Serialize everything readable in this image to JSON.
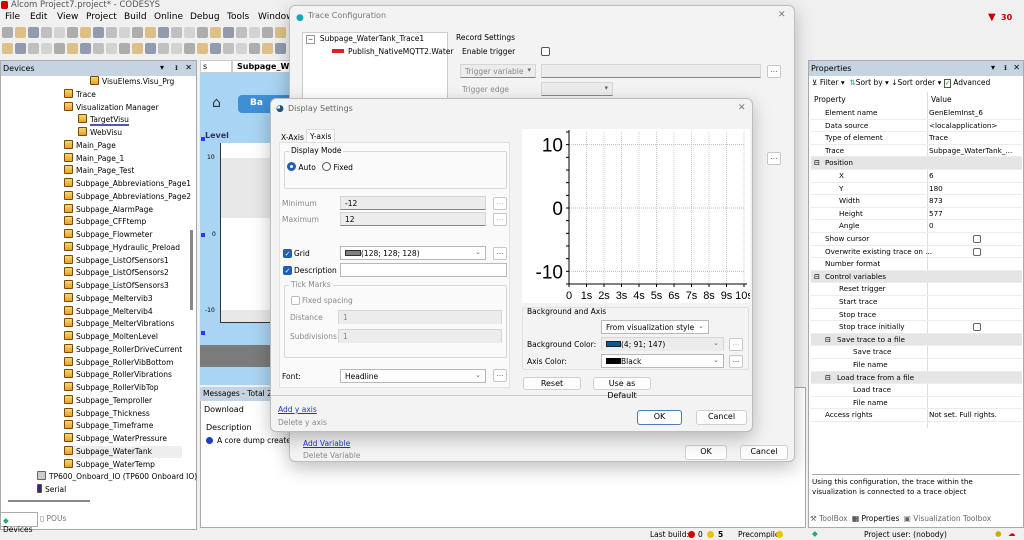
{
  "window": {
    "title": "Alcom Project7.project* - CODESYS",
    "error_count": "30"
  },
  "menu": [
    "File",
    "Edit",
    "View",
    "Project",
    "Build",
    "Online",
    "Debug",
    "Tools",
    "Window"
  ],
  "devices": {
    "title": "Devices",
    "items": [
      {
        "label": "VisuElems.Visu_Prg"
      },
      {
        "label": "Trace"
      },
      {
        "label": "Visualization Manager"
      },
      {
        "label": "TargetVisu"
      },
      {
        "label": "WebVisu"
      },
      {
        "label": "Main_Page"
      },
      {
        "label": "Main_Page_1"
      },
      {
        "label": "Main_Page_Test"
      },
      {
        "label": "Subpage_Abbreviations_Page1"
      },
      {
        "label": "Subpage_Abbreviations_Page2"
      },
      {
        "label": "Subpage_AlarmPage"
      },
      {
        "label": "Subpage_CFFtemp"
      },
      {
        "label": "Subpage_Flowmeter"
      },
      {
        "label": "Subpage_Hydraulic_Preload"
      },
      {
        "label": "Subpage_ListOfSensors1"
      },
      {
        "label": "Subpage_ListOfSensors2"
      },
      {
        "label": "Subpage_ListOfSensors3"
      },
      {
        "label": "Subpage_Meltervib3"
      },
      {
        "label": "Subpage_Meltervib4"
      },
      {
        "label": "Subpage_MelterVibrations"
      },
      {
        "label": "Subpage_MoltenLevel"
      },
      {
        "label": "Subpage_RollerDriveCurrent"
      },
      {
        "label": "Subpage_RollerVibBottom"
      },
      {
        "label": "Subpage_RollerVibrations"
      },
      {
        "label": "Subpage_RollerVibTop"
      },
      {
        "label": "Subpage_Temproller"
      },
      {
        "label": "Subpage_Thickness"
      },
      {
        "label": "Subpage_Timeframe"
      },
      {
        "label": "Subpage_WaterPressure"
      },
      {
        "label": "Subpage_WaterTank"
      },
      {
        "label": "Subpage_WaterTemp"
      },
      {
        "label": "TP600_Onboard_IO (TP600 Onboard IO)"
      },
      {
        "label": "Serial"
      }
    ],
    "tabs": [
      "Devices",
      "POUs"
    ]
  },
  "editor": {
    "tab_prev": "s",
    "tab_active": "Subpage_W",
    "button": "Ba",
    "trace_label": "Level",
    "ticks": [
      "10",
      "0",
      "-10"
    ]
  },
  "messages": {
    "title": "Messages - Total 2 e",
    "filter": "Download",
    "col": "Description",
    "row": "A core dump created"
  },
  "trace_config": {
    "title": "Trace Configuration",
    "tree_root": "Subpage_WaterTank_Trace1",
    "tree_var": "Publish_NativeMQTT2.Water",
    "record_settings": "Record Settings",
    "enable_trigger": "Enable trigger",
    "trigger_variable": "Trigger variable",
    "trigger_edge": "Trigger edge",
    "add_variable": "Add Variable",
    "delete_variable": "Delete Variable",
    "ok": "OK",
    "cancel": "Cancel"
  },
  "display_settings": {
    "title": "Display Settings",
    "tabs": [
      "X-Axis",
      "Y-axis"
    ],
    "display_mode": "Display Mode",
    "auto": "Auto",
    "fixed": "Fixed",
    "minimum_label": "Minimum",
    "minimum": "-12",
    "maximum_label": "Maximum",
    "maximum": "12",
    "grid": "Grid",
    "grid_color": "(128; 128; 128)",
    "description": "Description",
    "description_value": "",
    "tick_marks": "Tick Marks",
    "fixed_spacing": "Fixed spacing",
    "distance_label": "Distance",
    "distance": "1",
    "subdivisions_label": "Subdivisions",
    "subdivisions": "1",
    "font_label": "Font:",
    "font": "Headline",
    "add_axis": "Add y axis",
    "delete_axis": "Delete y axis",
    "bg_axis": "Background and Axis",
    "style": "From visualization style",
    "bg_color_label": "Background Color:",
    "bg_color": "(4; 91; 147)",
    "bg_swatch": "#045b93",
    "axis_color_label": "Axis Color:",
    "axis_color": "Black",
    "reset": "Reset",
    "use_default": "Use as Default",
    "ok": "OK",
    "cancel": "Cancel",
    "dots": "..."
  },
  "chart_data": {
    "type": "line",
    "title": "",
    "xlabel": "",
    "ylabel": "",
    "x_ticks": [
      "0",
      "1s",
      "2s",
      "3s",
      "4s",
      "5s",
      "6s",
      "7s",
      "8s",
      "9s",
      "10s"
    ],
    "y_ticks": [
      "10",
      "0",
      "-10"
    ],
    "xlim": [
      0,
      10
    ],
    "ylim": [
      -12,
      12
    ],
    "grid": true,
    "series": []
  },
  "properties": {
    "title": "Properties",
    "filter": "Filter",
    "sort_by": "Sort by",
    "sort_order": "Sort order",
    "advanced": "Advanced",
    "col_property": "Property",
    "col_value": "Value",
    "rows": [
      {
        "k": "Element name",
        "v": "GenElemInst_6",
        "lvl": 1
      },
      {
        "k": "Data source",
        "v": "<localapplication>",
        "lvl": 1
      },
      {
        "k": "Type of element",
        "v": "Trace",
        "lvl": 1
      },
      {
        "k": "Trace",
        "v": "Subpage_WaterTank_...",
        "lvl": 1
      },
      {
        "k": "Position",
        "v": "",
        "lvl": 0,
        "grp": true
      },
      {
        "k": "X",
        "v": "6",
        "lvl": 2
      },
      {
        "k": "Y",
        "v": "180",
        "lvl": 2
      },
      {
        "k": "Width",
        "v": "873",
        "lvl": 2
      },
      {
        "k": "Height",
        "v": "577",
        "lvl": 2
      },
      {
        "k": "Angle",
        "v": "0",
        "lvl": 2
      },
      {
        "k": "Show cursor",
        "v": "",
        "lvl": 1,
        "cb": true
      },
      {
        "k": "Overwrite existing trace on ...",
        "v": "",
        "lvl": 1,
        "cb": true
      },
      {
        "k": "Number format",
        "v": "",
        "lvl": 1
      },
      {
        "k": "Control variables",
        "v": "",
        "lvl": 0,
        "grp": true
      },
      {
        "k": "Reset trigger",
        "v": "",
        "lvl": 2
      },
      {
        "k": "Start trace",
        "v": "",
        "lvl": 2
      },
      {
        "k": "Stop trace",
        "v": "",
        "lvl": 2
      },
      {
        "k": "Stop trace initially",
        "v": "",
        "lvl": 2,
        "cb": true
      },
      {
        "k": "Save trace to a file",
        "v": "",
        "lvl": 1,
        "grp": true
      },
      {
        "k": "Save trace",
        "v": "",
        "lvl": 3
      },
      {
        "k": "File name",
        "v": "",
        "lvl": 3
      },
      {
        "k": "Load trace from a file",
        "v": "",
        "lvl": 1,
        "grp": true
      },
      {
        "k": "Load trace",
        "v": "",
        "lvl": 3
      },
      {
        "k": "File name",
        "v": "",
        "lvl": 3
      },
      {
        "k": "Access rights",
        "v": "Not set. Full rights.",
        "lvl": 1
      }
    ],
    "description": "Using this configuration, the trace within the visualization is connected to a trace object",
    "tabs": [
      "ToolBox",
      "Properties",
      "Visualization Toolbox"
    ]
  },
  "status": {
    "last_build": "Last build:",
    "errors": "0",
    "warnings": "5",
    "precompile": "Precompile",
    "user": "Project user: (nobody)"
  }
}
